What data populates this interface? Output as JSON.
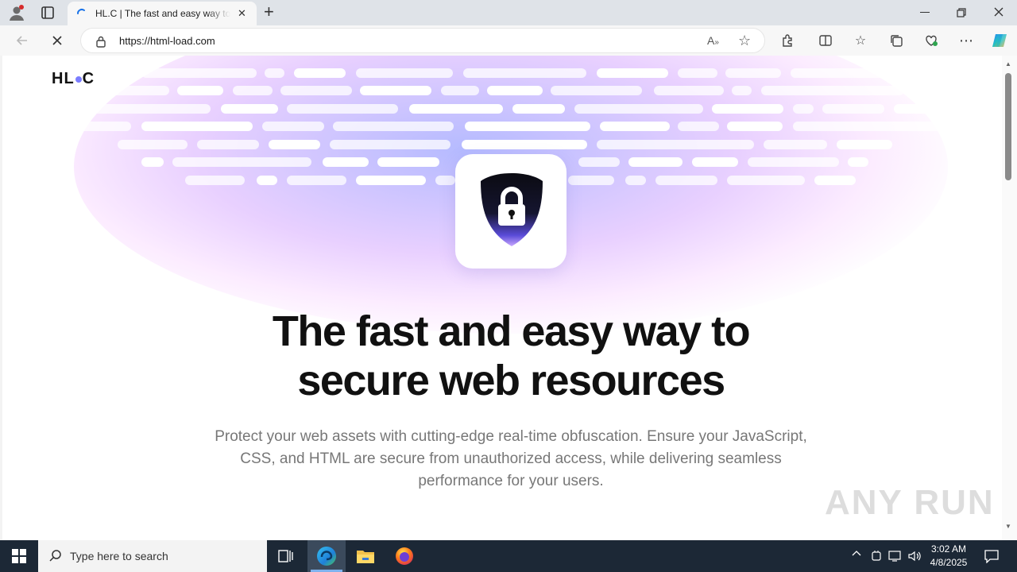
{
  "browser": {
    "tab_title": "HL.C | The fast and easy way to secure web resources",
    "url": "https://html-load.com",
    "new_tab_symbol": "+",
    "close_tab_symbol": "✕"
  },
  "page": {
    "logo_left": "HL",
    "logo_right": "C",
    "headline_line1": "The fast and easy way to",
    "headline_line2": "secure web resources",
    "subtext": "Protect your web assets with cutting-edge real-time obfuscation. Ensure your JavaScript, CSS, and HTML are secure from unauthorized access, while delivering seamless performance for your users.",
    "watermark": "ANY RUN"
  },
  "taskbar": {
    "search_placeholder": "Type here to search",
    "time": "3:02 AM",
    "date": "4/8/2025"
  },
  "colors": {
    "accent": "#7b7dff",
    "taskbar": "#1c2836",
    "shield_gradient_end": "#8a6cff"
  }
}
